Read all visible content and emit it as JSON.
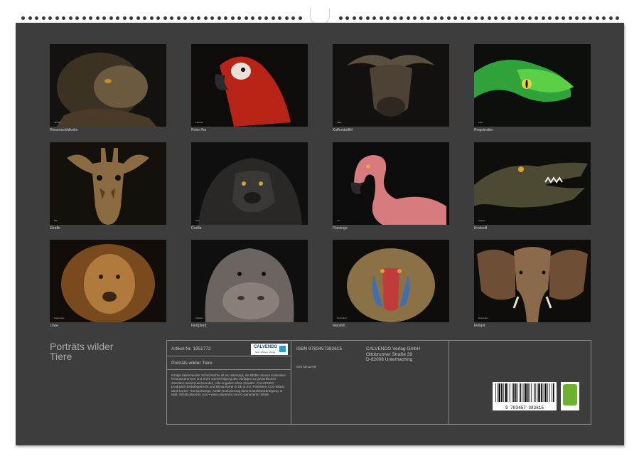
{
  "calendar": {
    "title_line1": "Porträts wilder",
    "title_line2": "Tiere"
  },
  "thumbnails": [
    {
      "caption": "Riesenschildkröte",
      "month": "Januar",
      "icon": "tortoise-portrait"
    },
    {
      "caption": "Roter Ara",
      "month": "Februar",
      "icon": "red-macaw-portrait"
    },
    {
      "caption": "Kaffernbüffel",
      "month": "März",
      "icon": "cape-buffalo-portrait"
    },
    {
      "caption": "Ringelnatter",
      "month": "April",
      "icon": "green-snake-portrait"
    },
    {
      "caption": "Giraffe",
      "month": "Mai",
      "icon": "giraffe-portrait"
    },
    {
      "caption": "Gorilla",
      "month": "Juni",
      "icon": "gorilla-portrait"
    },
    {
      "caption": "Flamingo",
      "month": "Juli",
      "icon": "flamingo-portrait"
    },
    {
      "caption": "Krokodil",
      "month": "August",
      "icon": "crocodile-portrait"
    },
    {
      "caption": "Löwe",
      "month": "September",
      "icon": "lion-portrait"
    },
    {
      "caption": "Flußpferd",
      "month": "Oktober",
      "icon": "hippo-portrait"
    },
    {
      "caption": "Mandrill",
      "month": "November",
      "icon": "mandrill-portrait"
    },
    {
      "caption": "Elefant",
      "month": "Dezember",
      "icon": "elephant-portrait"
    }
  ],
  "info": {
    "article_no": "Artikel-Nr. 1951772",
    "product_title": "Porträts wilder Tiere",
    "legal_text": "Infolge bestehender Schutzrechte ist es untersagt, die Blätter dieses Kalenders herauszutrennen und ohne Genehmigung des Verlages zu gewerblichen Zwecken weiterzuverwenden. Alle Angaben ohne Gewähr. CALVENDO produziert bedarfsgerecht und klimaneutral in DE & EU. Positivere CO2-Bilanz dank kurzer Transportwege. Abfall-Reduzierung dank Einzelstückfertigung. E-Mail: info@calvendo.com • www.calvendo.com KI-generierter Inhalt",
    "isbn": "ISBN 9783457382615",
    "author": "Dirk Meutzner",
    "publisher_name": "CALVENDO Verlag GmbH",
    "publisher_street": "Ottobrunner Straße 39",
    "publisher_city": "D-82008 Unterhaching",
    "logo_text": "CALVENDO",
    "logo_subtext": "Sieh. Erleben. Verlag",
    "barcode_number": "9 783457 382615",
    "eco_label": "eco"
  },
  "colors": {
    "background": "#3d3d3d",
    "text": "#cfcfcf",
    "eco_green": "#6bb32e",
    "logo_blue": "#1a3d8f"
  }
}
